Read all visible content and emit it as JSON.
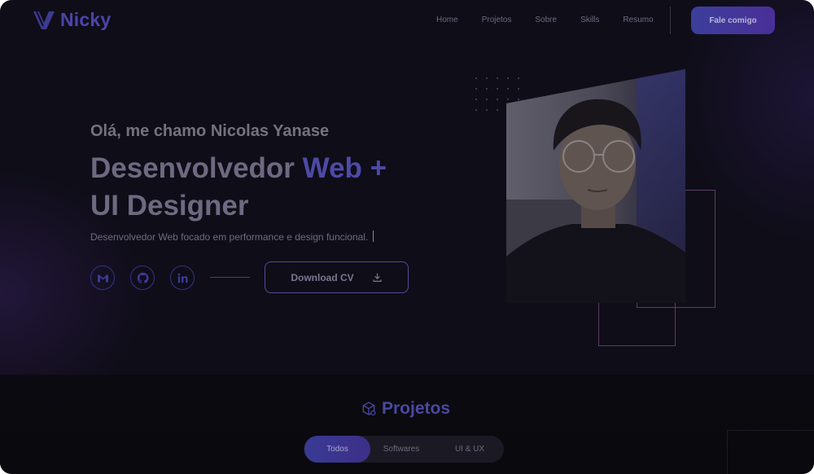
{
  "brand": {
    "name": "Nicky"
  },
  "nav": {
    "links": [
      "Home",
      "Projetos",
      "Sobre",
      "Skills",
      "Resumo"
    ],
    "cta": "Fale comigo"
  },
  "hero": {
    "greeting": "Olá, me chamo Nicolas Yanase",
    "title_part1": "Desenvolvedor",
    "title_accent": "Web +",
    "title_part2": "UI Designer",
    "subtitle": "Desenvolvedor Web focado em performance e design funcional.",
    "socials": [
      {
        "name": "gmail-icon"
      },
      {
        "name": "github-icon"
      },
      {
        "name": "linkedin-icon"
      }
    ],
    "download_label": "Download CV"
  },
  "projects": {
    "title": "Projetos",
    "filters": [
      "Todos",
      "Softwares",
      "UI & UX"
    ],
    "active_filter": "Todos"
  },
  "colors": {
    "background": "#0f0d18",
    "accent": "#4d4aa6",
    "text_muted": "#6f6c80"
  }
}
